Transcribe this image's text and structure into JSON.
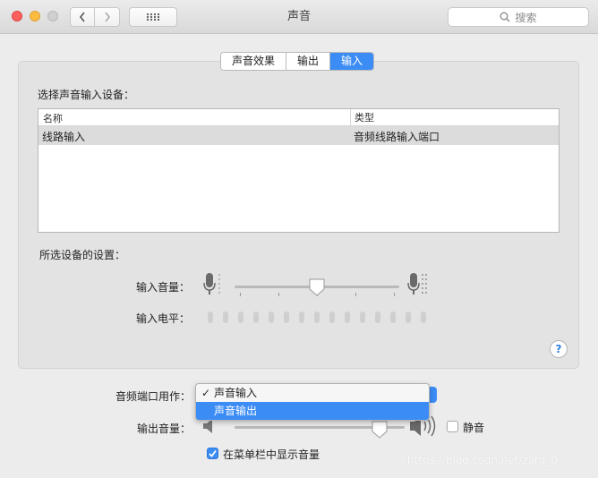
{
  "window": {
    "title": "声音",
    "search_placeholder": "搜索"
  },
  "tabs": [
    {
      "label": "声音效果",
      "active": false
    },
    {
      "label": "输出",
      "active": false
    },
    {
      "label": "输入",
      "active": true
    }
  ],
  "input": {
    "device_heading": "选择声音输入设备：",
    "table": {
      "columns": [
        "名称",
        "类型"
      ],
      "rows": [
        {
          "name": "线路输入",
          "type": "音频线路输入端口"
        }
      ]
    },
    "settings_heading": "所选设备的设置：",
    "volume_label": "输入音量：",
    "volume_value": 0.5,
    "level_label": "输入电平：",
    "level_cells": 15,
    "level_lit": 0
  },
  "port": {
    "label": "音频端口用作：",
    "options": [
      "声音输入",
      "声音输出"
    ],
    "selected": "声音输入",
    "highlighted": "声音输出"
  },
  "output": {
    "volume_label": "输出音量：",
    "volume_value": 0.85,
    "mute_label": "静音",
    "mute_checked": false,
    "menubar_label": "在菜单栏中显示音量",
    "menubar_checked": true
  },
  "watermark": "https://blog.csdn.net/zard_0_",
  "colors": {
    "accent": "#3c8cf5",
    "close": "#fc605c",
    "minimize": "#fdbc40"
  }
}
